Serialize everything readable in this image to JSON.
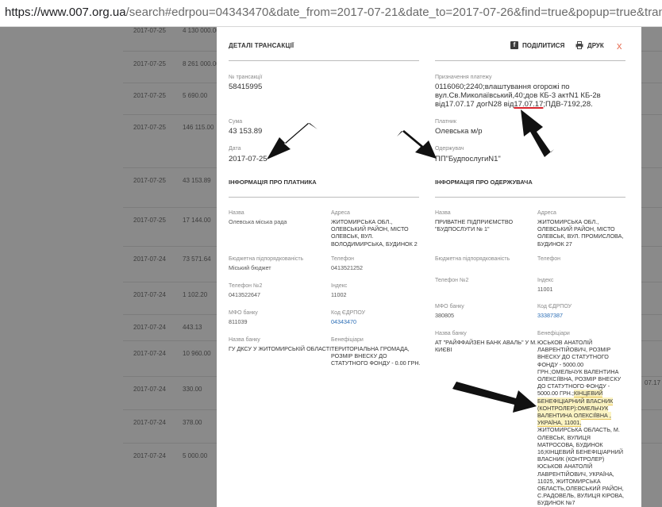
{
  "browser": {
    "url_host": "https://www.007.org.ua",
    "url_rest": "/search#edrpou=04343470&date_from=2017-07-21&date_to=2017-07-26&find=true&popup=true&transactio"
  },
  "background": {
    "rows": [
      {
        "date": "2017-07-25",
        "amount": "4 130 000.00"
      },
      {
        "date": "2017-07-25",
        "amount": "8 261 000.00"
      },
      {
        "date": "2017-07-25",
        "amount": "5 690.00"
      },
      {
        "date": "2017-07-25",
        "amount": "146 115.00"
      },
      {
        "date": "2017-07-25",
        "amount": "43 153.89"
      },
      {
        "date": "2017-07-25",
        "amount": "17 144.00"
      },
      {
        "date": "2017-07-24",
        "amount": "73 571.64"
      },
      {
        "date": "2017-07-24",
        "amount": "1 102.20"
      },
      {
        "date": "2017-07-24",
        "amount": "443.13"
      },
      {
        "date": "2017-07-24",
        "amount": "10 960.00"
      },
      {
        "date": "2017-07-24",
        "amount": "330.00"
      },
      {
        "date": "2017-07-24",
        "amount": "378.00"
      },
      {
        "date": "2017-07-24",
        "amount": "5 000.00"
      }
    ],
    "right_value": "07.17"
  },
  "modal": {
    "title": "ДЕТАЛІ ТРАНСАКЦІЇ",
    "share_label": "ПОДІЛИТИСЯ",
    "print_label": "ДРУК",
    "close_glyph": "x",
    "transaction_no_label": "№ трансакції",
    "transaction_no": "58415995",
    "sum_label": "Сума",
    "sum": "43 153.89",
    "date_label": "Дата",
    "date": "2017-07-25",
    "purpose_label": "Призначення платежу",
    "purpose_line1": "0116060;2240;влаштування огорожі по",
    "purpose_line2": "вул.Св.Миколаївський,40;дов КБ-3 актN1 КБ-2в",
    "purpose_line3_pre": "від17.07.17 догN28 від",
    "purpose_line3_mark": "17.07.17",
    "purpose_line3_post": ";ПДВ-7192,28.",
    "payer_label": "Платник",
    "payer": "Олевська м/р",
    "receiver_label": "Одержувач",
    "receiver": "ПП\"БудпослугиN1\"",
    "payer_section": "ІНФОРМАЦІЯ ПРО ПЛАТНИКА",
    "receiver_section": "ІНФОРМАЦІЯ ПРО ОДЕРЖУВАЧА",
    "payer_info": {
      "name_label": "Назва",
      "name": "Олевська міська рада",
      "address_label": "Адреса",
      "address": [
        "ЖИТОМИРСЬКА ОБЛ.,",
        "ОЛЕВСЬКИЙ РАЙОН, МІСТО",
        "ОЛЕВСЬК, ВУЛ.",
        "ВОЛОДИМИРСЬКА, БУДИНОК 2"
      ],
      "budget_label": "Бюджетна підпорядкованість",
      "budget": "Міський бюджет",
      "phone_label": "Телефон",
      "phone": "0413521252",
      "phone2_label": "Телефон №2",
      "phone2": "0413522647",
      "index_label": "Індекс",
      "index": "11002",
      "mfo_label": "МФО банку",
      "mfo": "811039",
      "edrpou_label": "Код ЄДРПОУ",
      "edrpou": "04343470",
      "bank_label": "Назва банку",
      "bank": "ГУ ДКСУ У ЖИТОМИРСЬКІЙ ОБЛАСТІ",
      "beneficiary_label": "Бенефіціари",
      "beneficiary": [
        "ТЕРИТОРІАЛЬНА ГРОМАДА,",
        "РОЗМІР ВНЕСКУ ДО",
        "СТАТУТНОГО ФОНДУ - 0.00 ГРН."
      ]
    },
    "receiver_info": {
      "name_label": "Назва",
      "name": [
        "ПРИВАТНЕ ПІДПРИЄМСТВО",
        "\"БУДПОСЛУГИ № 1\""
      ],
      "address_label": "Адреса",
      "address": [
        "ЖИТОМИРСЬКА ОБЛ.,",
        "ОЛЕВСЬКИЙ РАЙОН, МІСТО",
        "ОЛЕВСЬК, ВУЛ. ПРОМИСЛОВА,",
        "БУДИНОК 27"
      ],
      "budget_label": "Бюджетна підпорядкованість",
      "phone_label": "Телефон",
      "phone2_label": "Телефон №2",
      "index_label": "Індекс",
      "index": "11001",
      "mfo_label": "МФО банку",
      "mfo": "380805",
      "edrpou_label": "Код ЄДРПОУ",
      "edrpou": "33387387",
      "bank_label": "Назва банку",
      "bank": [
        "АТ \"РАЙФФАЙЗЕН БАНК АВАЛЬ\" У М.",
        "КИЄВІ"
      ],
      "beneficiary_label": "Бенефіціари",
      "beneficiary_pre": [
        "ЮСЬКОВ АНАТОЛІЙ",
        "ЛАВРЕНТІЙОВИЧ, РОЗМІР",
        "ВНЕСКУ ДО СТАТУТНОГО",
        "ФОНДУ - 5000.00",
        "ГРН.;ОМЕЛЬЧУК ВАЛЕНТИНА",
        "ОЛЕКСІЇВНА, РОЗМІР ВНЕСКУ",
        "ДО СТАТУТНОГО ФОНДУ -"
      ],
      "beneficiary_mixed": [
        "5000.00 ГРН.;",
        "КІНЦЕВИЙ"
      ],
      "beneficiary_hl": [
        "БЕНЕФІЦІАРНИЙ ВЛАСНИК",
        "(КОНТРОЛЕР):ОМЕЛЬЧУК",
        "ВАЛЕНТИНА ОЛЕКСІЇВНА ,",
        "УКРАЇНА, 11001,"
      ],
      "beneficiary_post": [
        "ЖИТОМИРСЬКА ОБЛАСТЬ, М.",
        "ОЛЕВСЬК, ВУЛИЦЯ",
        "МАТРОСОВА, БУДИНОК",
        "16;КІНЦЕВИЙ БЕНЕФІЦІАРНИЙ",
        "ВЛАСНИК (КОНТРОЛЕР)",
        "ЮСЬКОВ АНАТОЛІЙ",
        "ЛАВРЕНТІЙОВИЧ, УКРАЇНА,",
        "11025, ЖИТОМИРСЬКА",
        "ОБЛАСТЬ,ОЛЕВСЬКИЙ РАЙОН,",
        "С.РАДОВЕЛЬ, ВУЛИЦЯ КІРОВА,",
        "БУДИНОК №7"
      ]
    }
  }
}
